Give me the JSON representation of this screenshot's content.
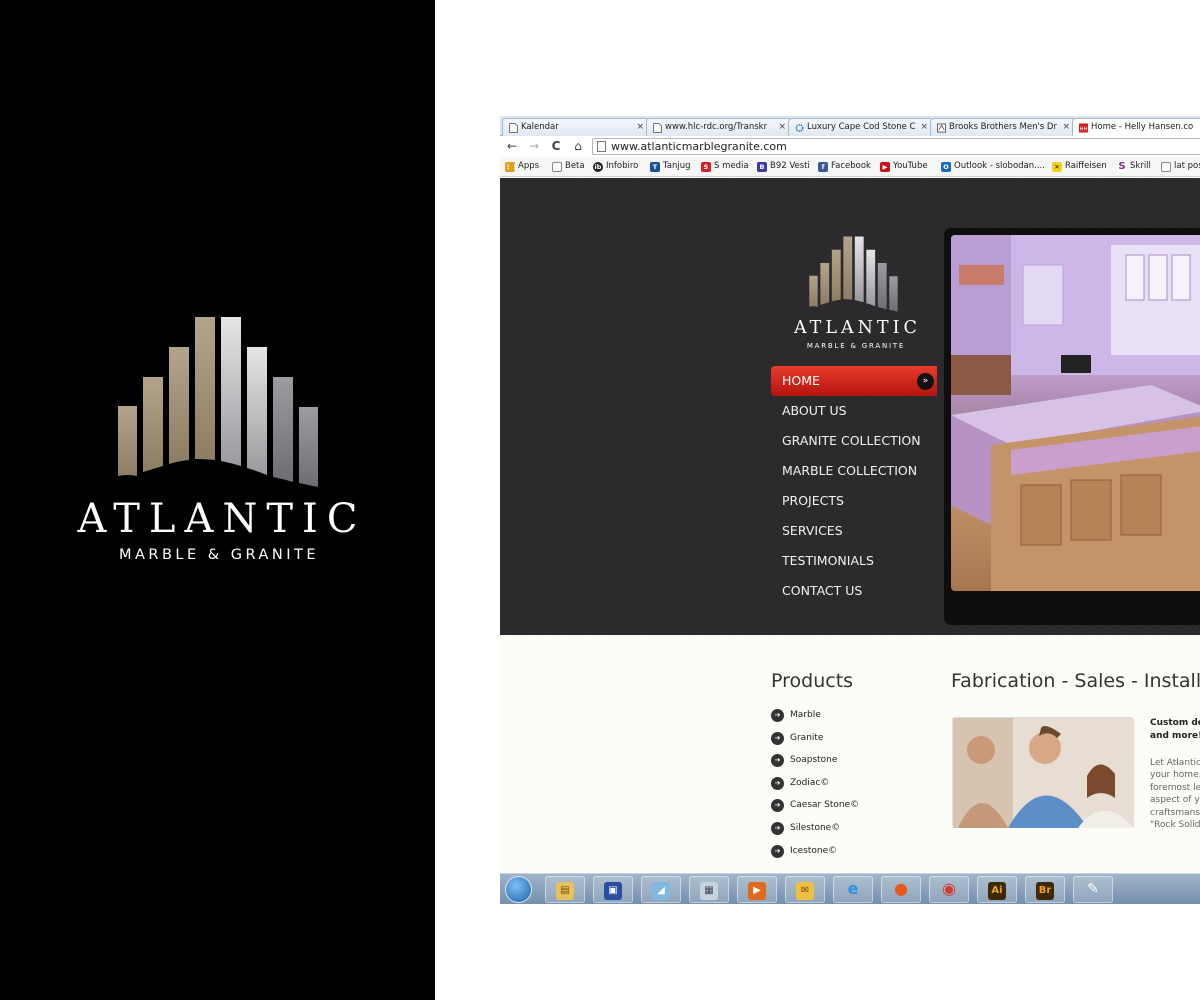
{
  "brand": {
    "name": "ATLANTIC",
    "tagline": "MARBLE & GRANITE"
  },
  "browser": {
    "tabs": [
      {
        "label": "Kalendar",
        "icon": "page-icon"
      },
      {
        "label": "www.hlc-rdc.org/Transkr",
        "icon": "page-icon"
      },
      {
        "label": "Luxury Cape Cod Stone C",
        "icon": "gear-icon"
      },
      {
        "label": "Brooks Brothers Men's Dr",
        "icon": "brooks-icon"
      },
      {
        "label": "Home - Helly Hansen.co",
        "icon": "hh-icon"
      }
    ],
    "tab_close": "×",
    "url": "www.atlanticmarblegranite.com",
    "nav": {
      "back": "←",
      "forward": "→",
      "reload": "C",
      "home": "⌂"
    },
    "bookmarks": [
      {
        "label": "Apps",
        "color": "#e0a020",
        "glyph": "⋮⋮"
      },
      {
        "label": "Beta",
        "color": "#ffffff",
        "glyph": ""
      },
      {
        "label": "Infobiro",
        "color": "#222222",
        "glyph": "ib"
      },
      {
        "label": "Tanjug",
        "color": "#1a4f9c",
        "glyph": "T"
      },
      {
        "label": "S media",
        "color": "#d42020",
        "glyph": "S"
      },
      {
        "label": "B92 Vesti",
        "color": "#3a3aa0",
        "glyph": "B"
      },
      {
        "label": "Facebook",
        "color": "#3b5998",
        "glyph": "f"
      },
      {
        "label": "YouTube",
        "color": "#cc1010",
        "glyph": "▶"
      },
      {
        "label": "Outlook - slobodan....",
        "color": "#1a6bc2",
        "glyph": "O"
      },
      {
        "label": "Raiffeisen",
        "color": "#f2d21e",
        "glyph": "✕"
      },
      {
        "label": "Skrill",
        "color": "#7b2c8c",
        "glyph": "S"
      },
      {
        "label": "lat pos",
        "color": "#ffffff",
        "glyph": ""
      }
    ]
  },
  "site": {
    "logo_name": "ATLANTIC",
    "logo_tagline": "MARBLE & GRANITE",
    "menu": [
      {
        "label": "HOME",
        "active": true
      },
      {
        "label": "ABOUT US"
      },
      {
        "label": "GRANITE COLLECTION"
      },
      {
        "label": "MARBLE COLLECTION"
      },
      {
        "label": "PROJECTS"
      },
      {
        "label": "SERVICES"
      },
      {
        "label": "TESTIMONIALS"
      },
      {
        "label": "CONTACT US"
      }
    ],
    "menu_arrow": "»",
    "products_title": "Products",
    "products": [
      "Marble",
      "Granite",
      "Soapstone",
      "Zodiac©",
      "Caesar Stone©",
      "Silestone©",
      "Icestone©"
    ],
    "product_bullet": "➔",
    "fabrication_title": "Fabrication - Sales - Install",
    "custom_title_line1": "Custom des",
    "custom_title_line2": "and more!",
    "body_lines": [
      "Let Atlantic",
      "your home.",
      "foremost le",
      "aspect of y",
      "craftsmansl",
      "\"Rock Solid"
    ]
  },
  "taskbar": {
    "items": [
      {
        "name": "explorer-icon",
        "glyph": "▤",
        "color": "#e8c15a"
      },
      {
        "name": "save-icon",
        "glyph": "▣",
        "color": "#2a4fa0"
      },
      {
        "name": "media-icon",
        "glyph": "◢",
        "color": "#7fb8e0"
      },
      {
        "name": "calculator-icon",
        "glyph": "▦",
        "color": "#c7d3de"
      },
      {
        "name": "powerpoint-icon",
        "glyph": "▶",
        "color": "#e06a1a"
      },
      {
        "name": "outlook-icon",
        "glyph": "✉",
        "color": "#f0c040"
      },
      {
        "name": "ie-icon",
        "glyph": "e",
        "color": "#2d8fe0"
      },
      {
        "name": "firefox-icon",
        "glyph": "●",
        "color": "#e8581a"
      },
      {
        "name": "chrome-icon",
        "glyph": "◉",
        "color": "#d63a2a"
      },
      {
        "name": "illustrator-icon",
        "glyph": "Ai",
        "color": "#3d2a05"
      },
      {
        "name": "bridge-icon",
        "glyph": "Br",
        "color": "#3d2a05"
      },
      {
        "name": "paint-icon",
        "glyph": "✎",
        "color": "#d8c070"
      }
    ]
  }
}
